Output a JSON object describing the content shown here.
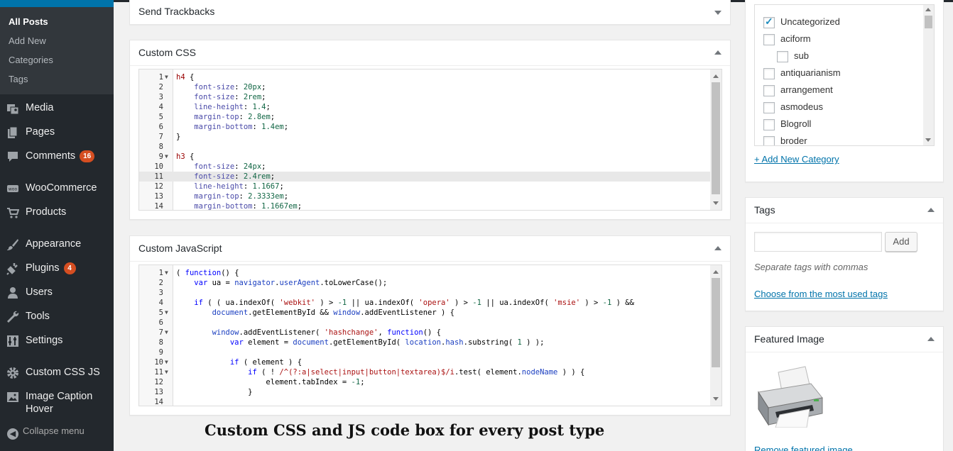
{
  "sidebar": {
    "submenu": [
      "All Posts",
      "Add New",
      "Categories",
      "Tags"
    ],
    "items": [
      {
        "label": "Media",
        "icon": "media-icon"
      },
      {
        "label": "Pages",
        "icon": "pages-icon"
      },
      {
        "label": "Comments",
        "icon": "comments-icon",
        "badge": "16"
      },
      {
        "label": "WooCommerce",
        "icon": "woocommerce-icon"
      },
      {
        "label": "Products",
        "icon": "products-cart-icon"
      },
      {
        "label": "Appearance",
        "icon": "appearance-brush-icon"
      },
      {
        "label": "Plugins",
        "icon": "plugins-icon",
        "badge": "4"
      },
      {
        "label": "Users",
        "icon": "users-icon"
      },
      {
        "label": "Tools",
        "icon": "tools-wrench-icon"
      },
      {
        "label": "Settings",
        "icon": "settings-sliders-icon"
      },
      {
        "label": "Custom CSS JS",
        "icon": "gear-icon"
      },
      {
        "label": "Image Caption Hover",
        "icon": "image-icon"
      }
    ],
    "collapse": "Collapse menu"
  },
  "boxes": {
    "trackbacks": "Send Trackbacks",
    "css": "Custom CSS",
    "js": "Custom JavaScript"
  },
  "css_lines": [
    "h4 {",
    "    font-size: 20px;",
    "    font-size: 2rem;",
    "    line-height: 1.4;",
    "    margin-top: 2.8em;",
    "    margin-bottom: 1.4em;",
    "}",
    "",
    "h3 {",
    "    font-size: 24px;",
    "    font-size: 2.4rem;",
    "    line-height: 1.1667;",
    "    margin-top: 2.3333em;",
    "    margin-bottom: 1.1667em;"
  ],
  "js_lines": [
    "( function() {",
    "    var ua = navigator.userAgent.toLowerCase();",
    "",
    "    if ( ( ua.indexOf( 'webkit' ) > -1 || ua.indexOf( 'opera' ) > -1 || ua.indexOf( 'msie' ) > -1 ) &&",
    "        document.getElementById && window.addEventListener ) {",
    "",
    "        window.addEventListener( 'hashchange', function() {",
    "            var element = document.getElementById( location.hash.substring( 1 ) );",
    "",
    "            if ( element ) {",
    "                if ( ! /^(?:a|select|input|button|textarea)$/i.test( element.nodeName ) ) {",
    "                    element.tabIndex = -1;",
    "                }",
    ""
  ],
  "caption": "Custom CSS and JS code box for every post type",
  "categories": [
    {
      "label": "Uncategorized",
      "checked": true,
      "indent": false
    },
    {
      "label": "aciform",
      "checked": false,
      "indent": false
    },
    {
      "label": "sub",
      "checked": false,
      "indent": true
    },
    {
      "label": "antiquarianism",
      "checked": false,
      "indent": false
    },
    {
      "label": "arrangement",
      "checked": false,
      "indent": false
    },
    {
      "label": "asmodeus",
      "checked": false,
      "indent": false
    },
    {
      "label": "Blogroll",
      "checked": false,
      "indent": false
    },
    {
      "label": "broder",
      "checked": false,
      "indent": false
    }
  ],
  "add_category": "+ Add New Category",
  "tags": {
    "title": "Tags",
    "add_button": "Add",
    "input_value": "",
    "hint": "Separate tags with commas",
    "most_used": "Choose from the most used tags"
  },
  "featured": {
    "title": "Featured Image",
    "image_icon": "printer-icon",
    "remove": "Remove featured image"
  }
}
